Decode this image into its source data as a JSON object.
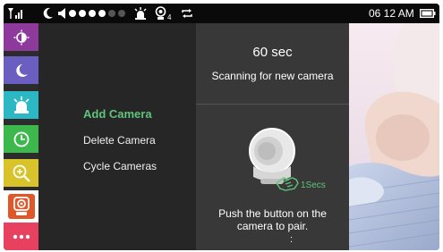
{
  "status_bar": {
    "time": "06 12 AM",
    "camera_count": "4",
    "icons": [
      "signal-icon",
      "moon-icon",
      "volume-icon",
      "volume-level-icon",
      "alarm-icon",
      "camera-count-icon",
      "repeat-icon",
      "battery-icon"
    ],
    "volume_level": 4,
    "volume_max": 6
  },
  "sidebar": {
    "items": [
      {
        "name": "brightness",
        "icon": "brightness-icon",
        "color": "#8e3a9d"
      },
      {
        "name": "lullaby",
        "icon": "moon-music-icon",
        "color": "#6a5fc0"
      },
      {
        "name": "alarm",
        "icon": "alarm-icon",
        "color": "#2bb8c4"
      },
      {
        "name": "timer",
        "icon": "clock-icon",
        "color": "#3cb84c"
      },
      {
        "name": "zoom",
        "icon": "zoom-in-icon",
        "color": "#d8c42a"
      },
      {
        "name": "camera",
        "icon": "camera-icon",
        "color": "#e0582a",
        "active": true
      },
      {
        "name": "more",
        "icon": "more-icon",
        "color": "#e8405f"
      }
    ]
  },
  "menu": {
    "items": [
      "Add Camera",
      "Delete Camera",
      "Cycle Cameras"
    ],
    "selected": "Add Camera"
  },
  "scan": {
    "countdown": "60 sec",
    "status": "Scanning for new camera",
    "press_duration": "1Secs",
    "instruction_line1": "Push the button on the",
    "instruction_line2": "camera to pair.",
    "extra": ":"
  },
  "colors": {
    "accent_green": "#5fc47a",
    "panel_dark": "#262626",
    "panel_mid": "#383838"
  }
}
